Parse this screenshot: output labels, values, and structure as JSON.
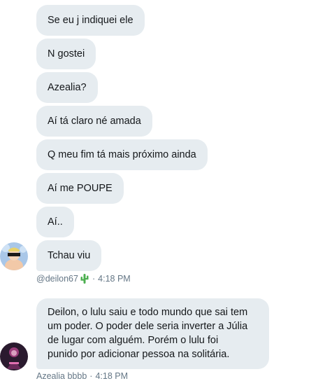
{
  "conversation": {
    "messages_group_1": [
      "Se eu j indiquei ele",
      "N gostei",
      "Azealia?",
      "Aí tá claro né amada",
      "Q meu fim tá mais próximo ainda",
      "Aí me POUPE",
      "Aí..",
      "Tchau viu"
    ],
    "sender_1": {
      "handle": "@deilon67",
      "time": "4:18 PM",
      "emoji_icon": "cactus-icon"
    },
    "message_group_2": {
      "lines": [
        "Deilon, o lulu saiu e todo mundo que sai tem",
        "um poder. O poder dele seria inverter a Júlia",
        "de lugar com alguém. Porém o lulu foi",
        "punido por adicionar pessoa na solitária."
      ]
    },
    "sender_2": {
      "handle": "Azealia bbbb",
      "time": "4:18 PM"
    }
  },
  "colors": {
    "bubble_bg": "#e6ecf0",
    "text": "#14171a",
    "meta": "#657786",
    "cactus": "#4caf50"
  }
}
